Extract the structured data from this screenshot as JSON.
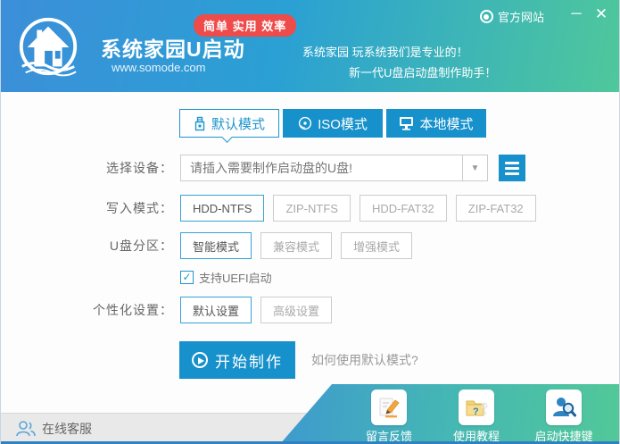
{
  "titlebar": {
    "official_site": "官方网站",
    "minimize": "─",
    "close": "✕"
  },
  "header": {
    "app_name": "系统家园U启动",
    "website": "www.somode.com",
    "badge": "简单 实用 效率",
    "slogan_line1": "系统家园 玩系统我们是专业的！",
    "slogan_line2": "新一代U盘启动盘制作助手！"
  },
  "tabs": [
    {
      "label": "默认模式",
      "active": true
    },
    {
      "label": "ISO模式",
      "active": false
    },
    {
      "label": "本地模式",
      "active": false
    }
  ],
  "form": {
    "device_label": "选择设备：",
    "device_placeholder": "请插入需要制作启动盘的U盘!",
    "write_label": "写入模式：",
    "write_options": [
      "HDD-NTFS",
      "ZIP-NTFS",
      "HDD-FAT32",
      "ZIP-FAT32"
    ],
    "write_selected": "HDD-NTFS",
    "partition_label": "U盘分区：",
    "partition_options": [
      "智能模式",
      "兼容模式",
      "增强模式"
    ],
    "partition_selected": "智能模式",
    "uefi_check": "✓",
    "uefi_label": "支持UEFI启动",
    "uefi_checked": true,
    "personal_label": "个性化设置：",
    "personal_options": [
      "默认设置",
      "高级设置"
    ],
    "personal_selected": "默认设置",
    "start_label": "开始制作",
    "help_text": "如何使用默认模式?"
  },
  "footer": {
    "online_service": "在线客服",
    "shortcuts": [
      "留言反馈",
      "使用教程",
      "启动快捷键"
    ]
  },
  "colors": {
    "accent_blue": "#1791cb",
    "header_blue": "#3c8fd9",
    "header_green": "#4fc89b",
    "badge_red": "#ee4b4b"
  }
}
